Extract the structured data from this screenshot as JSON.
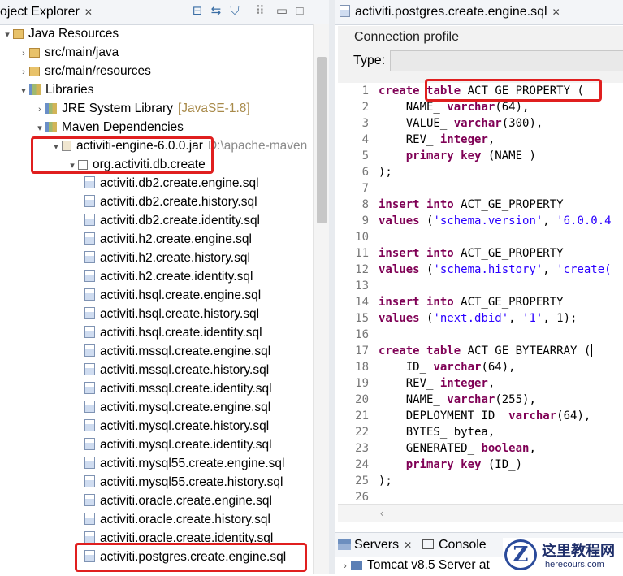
{
  "project_explorer": {
    "tab_label": "oject Explorer",
    "close": "✕",
    "toolbar_icons": [
      "collapse-all-icon",
      "link-with-editor-icon",
      "filter-icon",
      "view-menu-icon",
      "minimize-icon",
      "maximize-icon"
    ],
    "tree": [
      {
        "label": "Java Resources",
        "indent": 0,
        "chevron": "▾",
        "icon": "pkg"
      },
      {
        "label": "src/main/java",
        "indent": 1,
        "chevron": "›",
        "icon": "pkg"
      },
      {
        "label": "src/main/resources",
        "indent": 1,
        "chevron": "›",
        "icon": "pkg"
      },
      {
        "label": "Libraries",
        "indent": 1,
        "chevron": "▾",
        "icon": "lib"
      },
      {
        "label": "JRE System Library",
        "suffix": "[JavaSE-1.8]",
        "indent": 2,
        "chevron": "›",
        "icon": "lib"
      },
      {
        "label": "Maven Dependencies",
        "indent": 2,
        "chevron": "▾",
        "icon": "lib"
      },
      {
        "label": "activiti-engine-6.0.0.jar",
        "suffix": "D:\\apache-maven",
        "indent": 3,
        "chevron": "▾",
        "icon": "jar"
      },
      {
        "label": "org.activiti.db.create",
        "indent": 4,
        "chevron": "▾",
        "icon": "pk2"
      },
      {
        "label": "activiti.db2.create.engine.sql",
        "indent": 5,
        "icon": "file"
      },
      {
        "label": "activiti.db2.create.history.sql",
        "indent": 5,
        "icon": "file"
      },
      {
        "label": "activiti.db2.create.identity.sql",
        "indent": 5,
        "icon": "file"
      },
      {
        "label": "activiti.h2.create.engine.sql",
        "indent": 5,
        "icon": "file"
      },
      {
        "label": "activiti.h2.create.history.sql",
        "indent": 5,
        "icon": "file"
      },
      {
        "label": "activiti.h2.create.identity.sql",
        "indent": 5,
        "icon": "file"
      },
      {
        "label": "activiti.hsql.create.engine.sql",
        "indent": 5,
        "icon": "file"
      },
      {
        "label": "activiti.hsql.create.history.sql",
        "indent": 5,
        "icon": "file"
      },
      {
        "label": "activiti.hsql.create.identity.sql",
        "indent": 5,
        "icon": "file"
      },
      {
        "label": "activiti.mssql.create.engine.sql",
        "indent": 5,
        "icon": "file"
      },
      {
        "label": "activiti.mssql.create.history.sql",
        "indent": 5,
        "icon": "file"
      },
      {
        "label": "activiti.mssql.create.identity.sql",
        "indent": 5,
        "icon": "file"
      },
      {
        "label": "activiti.mysql.create.engine.sql",
        "indent": 5,
        "icon": "file"
      },
      {
        "label": "activiti.mysql.create.history.sql",
        "indent": 5,
        "icon": "file"
      },
      {
        "label": "activiti.mysql.create.identity.sql",
        "indent": 5,
        "icon": "file"
      },
      {
        "label": "activiti.mysql55.create.engine.sql",
        "indent": 5,
        "icon": "file"
      },
      {
        "label": "activiti.mysql55.create.history.sql",
        "indent": 5,
        "icon": "file"
      },
      {
        "label": "activiti.oracle.create.engine.sql",
        "indent": 5,
        "icon": "file"
      },
      {
        "label": "activiti.oracle.create.history.sql",
        "indent": 5,
        "icon": "file"
      },
      {
        "label": "activiti.oracle.create.identity.sql",
        "indent": 5,
        "icon": "file"
      },
      {
        "label": "activiti.postgres.create.engine.sql",
        "indent": 5,
        "icon": "file"
      }
    ]
  },
  "editor": {
    "tab_label": "activiti.postgres.create.engine.sql",
    "close": "✕",
    "connection_profile": "Connection profile",
    "type_label": "Type:",
    "lines": [
      [
        {
          "t": "create ",
          "c": "kw"
        },
        {
          "t": "table",
          "c": "kw"
        },
        {
          "t": " ACT_GE_PROPERTY (",
          "c": ""
        }
      ],
      [
        {
          "t": "    NAME_ ",
          "c": ""
        },
        {
          "t": "varchar",
          "c": "kw"
        },
        {
          "t": "(64),",
          "c": ""
        }
      ],
      [
        {
          "t": "    VALUE_ ",
          "c": ""
        },
        {
          "t": "varchar",
          "c": "kw"
        },
        {
          "t": "(300),",
          "c": ""
        }
      ],
      [
        {
          "t": "    REV_ ",
          "c": ""
        },
        {
          "t": "integer",
          "c": "kw"
        },
        {
          "t": ",",
          "c": ""
        }
      ],
      [
        {
          "t": "    ",
          "c": ""
        },
        {
          "t": "primary key",
          "c": "kw"
        },
        {
          "t": " (NAME_)",
          "c": ""
        }
      ],
      [
        {
          "t": ");",
          "c": ""
        }
      ],
      [],
      [
        {
          "t": "insert into",
          "c": "kw"
        },
        {
          "t": " ACT_GE_PROPERTY",
          "c": ""
        }
      ],
      [
        {
          "t": "values",
          "c": "kw"
        },
        {
          "t": " (",
          "c": ""
        },
        {
          "t": "'schema.version'",
          "c": "str"
        },
        {
          "t": ", ",
          "c": ""
        },
        {
          "t": "'6.0.0.4",
          "c": "str"
        }
      ],
      [],
      [
        {
          "t": "insert into",
          "c": "kw"
        },
        {
          "t": " ACT_GE_PROPERTY",
          "c": ""
        }
      ],
      [
        {
          "t": "values",
          "c": "kw"
        },
        {
          "t": " (",
          "c": ""
        },
        {
          "t": "'schema.history'",
          "c": "str"
        },
        {
          "t": ", ",
          "c": ""
        },
        {
          "t": "'create(",
          "c": "str"
        }
      ],
      [],
      [
        {
          "t": "insert into",
          "c": "kw"
        },
        {
          "t": " ACT_GE_PROPERTY",
          "c": ""
        }
      ],
      [
        {
          "t": "values",
          "c": "kw"
        },
        {
          "t": " (",
          "c": ""
        },
        {
          "t": "'next.dbid'",
          "c": "str"
        },
        {
          "t": ", ",
          "c": ""
        },
        {
          "t": "'1'",
          "c": "str"
        },
        {
          "t": ", 1);",
          "c": ""
        }
      ],
      [],
      [
        {
          "t": "create table",
          "c": "kw"
        },
        {
          "t": " ACT_GE_BYTEARRAY (",
          "c": ""
        },
        {
          "t": "",
          "c": "cursor"
        }
      ],
      [
        {
          "t": "    ID_ ",
          "c": ""
        },
        {
          "t": "varchar",
          "c": "kw"
        },
        {
          "t": "(64),",
          "c": ""
        }
      ],
      [
        {
          "t": "    REV_ ",
          "c": ""
        },
        {
          "t": "integer",
          "c": "kw"
        },
        {
          "t": ",",
          "c": ""
        }
      ],
      [
        {
          "t": "    NAME_ ",
          "c": ""
        },
        {
          "t": "varchar",
          "c": "kw"
        },
        {
          "t": "(255),",
          "c": ""
        }
      ],
      [
        {
          "t": "    DEPLOYMENT_ID_ ",
          "c": ""
        },
        {
          "t": "varchar",
          "c": "kw"
        },
        {
          "t": "(64),",
          "c": ""
        }
      ],
      [
        {
          "t": "    BYTES_ bytea,",
          "c": ""
        }
      ],
      [
        {
          "t": "    GENERATED_ ",
          "c": ""
        },
        {
          "t": "boolean",
          "c": "kw"
        },
        {
          "t": ",",
          "c": ""
        }
      ],
      [
        {
          "t": "    ",
          "c": ""
        },
        {
          "t": "primary key",
          "c": "kw"
        },
        {
          "t": " (ID_)",
          "c": ""
        }
      ],
      [
        {
          "t": ");",
          "c": ""
        }
      ],
      []
    ]
  },
  "bottom_panel": {
    "servers_tab": "Servers",
    "console_tab": "Console",
    "server_entry": "Tomcat v8.5 Server at"
  },
  "watermark": {
    "logo_letter": "Z",
    "chinese": "这里教程网",
    "url": "herecours.com"
  },
  "colors": {
    "highlight": "#e01f1f",
    "keyword": "#7f0055",
    "string": "#2a00ff"
  }
}
